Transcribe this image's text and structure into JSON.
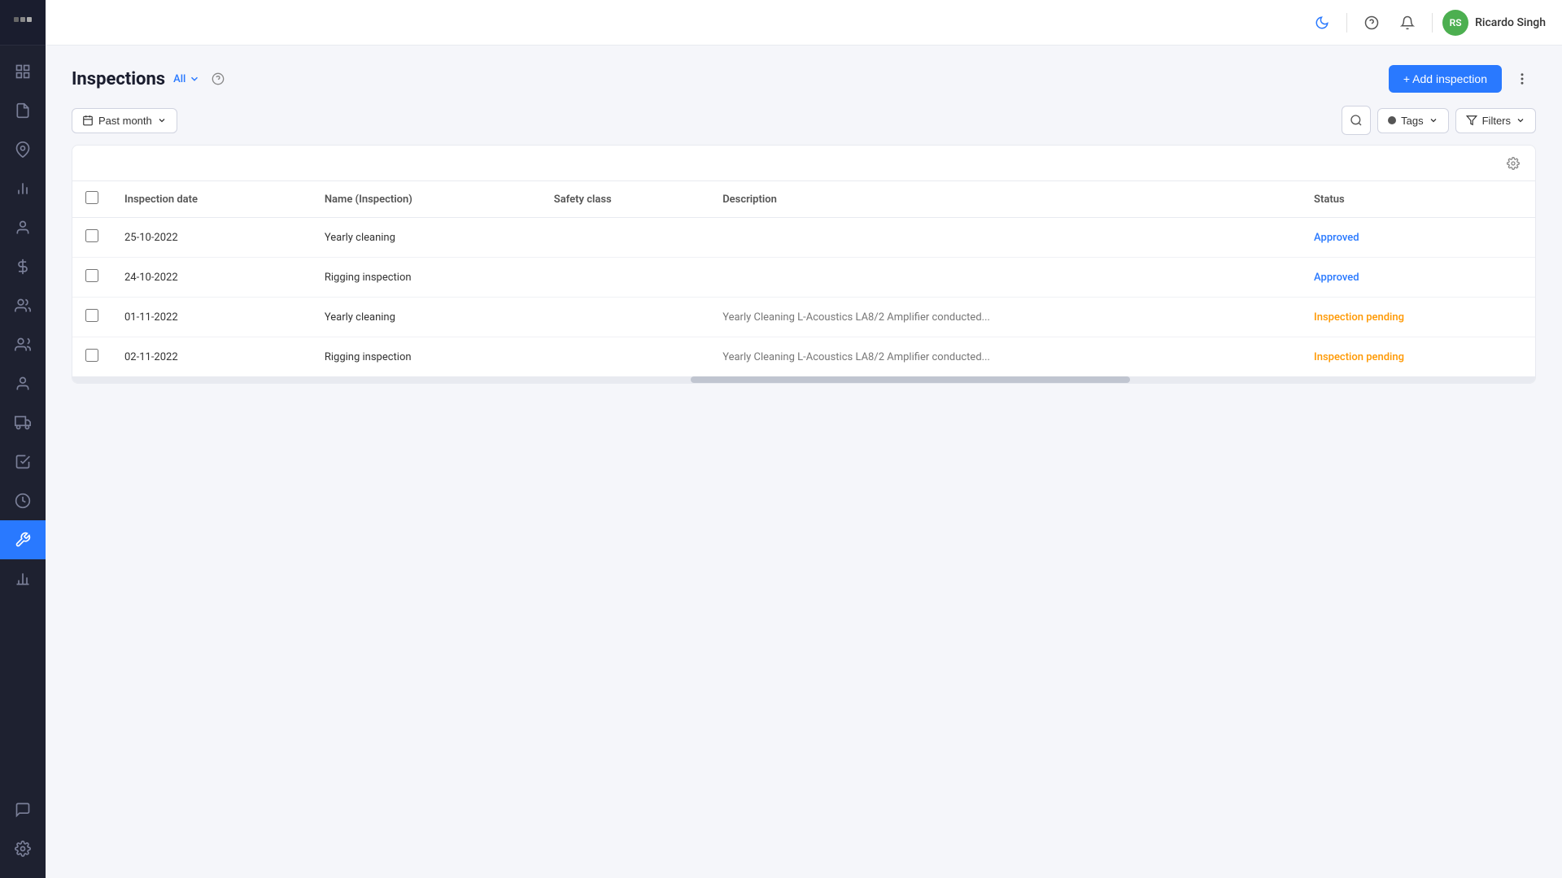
{
  "sidebar": {
    "logo": "···",
    "items": [
      {
        "id": "dashboard",
        "icon": "grid",
        "active": false
      },
      {
        "id": "assets",
        "icon": "clipboard",
        "active": false
      },
      {
        "id": "location",
        "icon": "map-pin",
        "active": false
      },
      {
        "id": "reports",
        "icon": "bar-chart",
        "active": false
      },
      {
        "id": "user-circle",
        "icon": "user-circle",
        "active": false
      },
      {
        "id": "money",
        "icon": "dollar",
        "active": false
      },
      {
        "id": "team",
        "icon": "users-team",
        "active": false
      },
      {
        "id": "contacts",
        "icon": "users",
        "active": false
      },
      {
        "id": "people",
        "icon": "person",
        "active": false
      },
      {
        "id": "transport",
        "icon": "truck",
        "active": false
      },
      {
        "id": "tasks",
        "icon": "check-square",
        "active": false
      },
      {
        "id": "history",
        "icon": "clock",
        "active": false
      },
      {
        "id": "inspections",
        "icon": "wrench",
        "active": true
      },
      {
        "id": "analytics",
        "icon": "analytics",
        "active": false
      },
      {
        "id": "messages",
        "icon": "message",
        "active": false
      },
      {
        "id": "settings",
        "icon": "gear",
        "active": false
      }
    ]
  },
  "topbar": {
    "mode_icon": "half-circle",
    "help_icon": "question",
    "notification_icon": "bell",
    "user": {
      "initials": "RS",
      "name": "Ricardo Singh"
    }
  },
  "page": {
    "title": "Inspections",
    "filter_label": "All",
    "add_button": "+ Add inspection",
    "date_filter": "Past month",
    "tags_label": "Tags",
    "filters_label": "Filters"
  },
  "table": {
    "columns": [
      {
        "id": "inspection_date",
        "label": "Inspection date"
      },
      {
        "id": "name",
        "label": "Name (Inspection)"
      },
      {
        "id": "safety_class",
        "label": "Safety class"
      },
      {
        "id": "description",
        "label": "Description"
      },
      {
        "id": "status",
        "label": "Status"
      }
    ],
    "rows": [
      {
        "id": 1,
        "inspection_date": "25-10-2022",
        "name": "Yearly cleaning",
        "safety_class": "",
        "description": "",
        "status": "Approved",
        "status_class": "approved"
      },
      {
        "id": 2,
        "inspection_date": "24-10-2022",
        "name": "Rigging inspection",
        "safety_class": "",
        "description": "",
        "status": "Approved",
        "status_class": "approved"
      },
      {
        "id": 3,
        "inspection_date": "01-11-2022",
        "name": "Yearly cleaning",
        "safety_class": "",
        "description": "Yearly Cleaning L-Acoustics LA8/2 Amplifier conducted...",
        "status": "Inspection pending",
        "status_class": "pending"
      },
      {
        "id": 4,
        "inspection_date": "02-11-2022",
        "name": "Rigging inspection",
        "safety_class": "",
        "description": "Yearly Cleaning L-Acoustics LA8/2 Amplifier conducted...",
        "status": "Inspection pending",
        "status_class": "pending"
      }
    ]
  }
}
